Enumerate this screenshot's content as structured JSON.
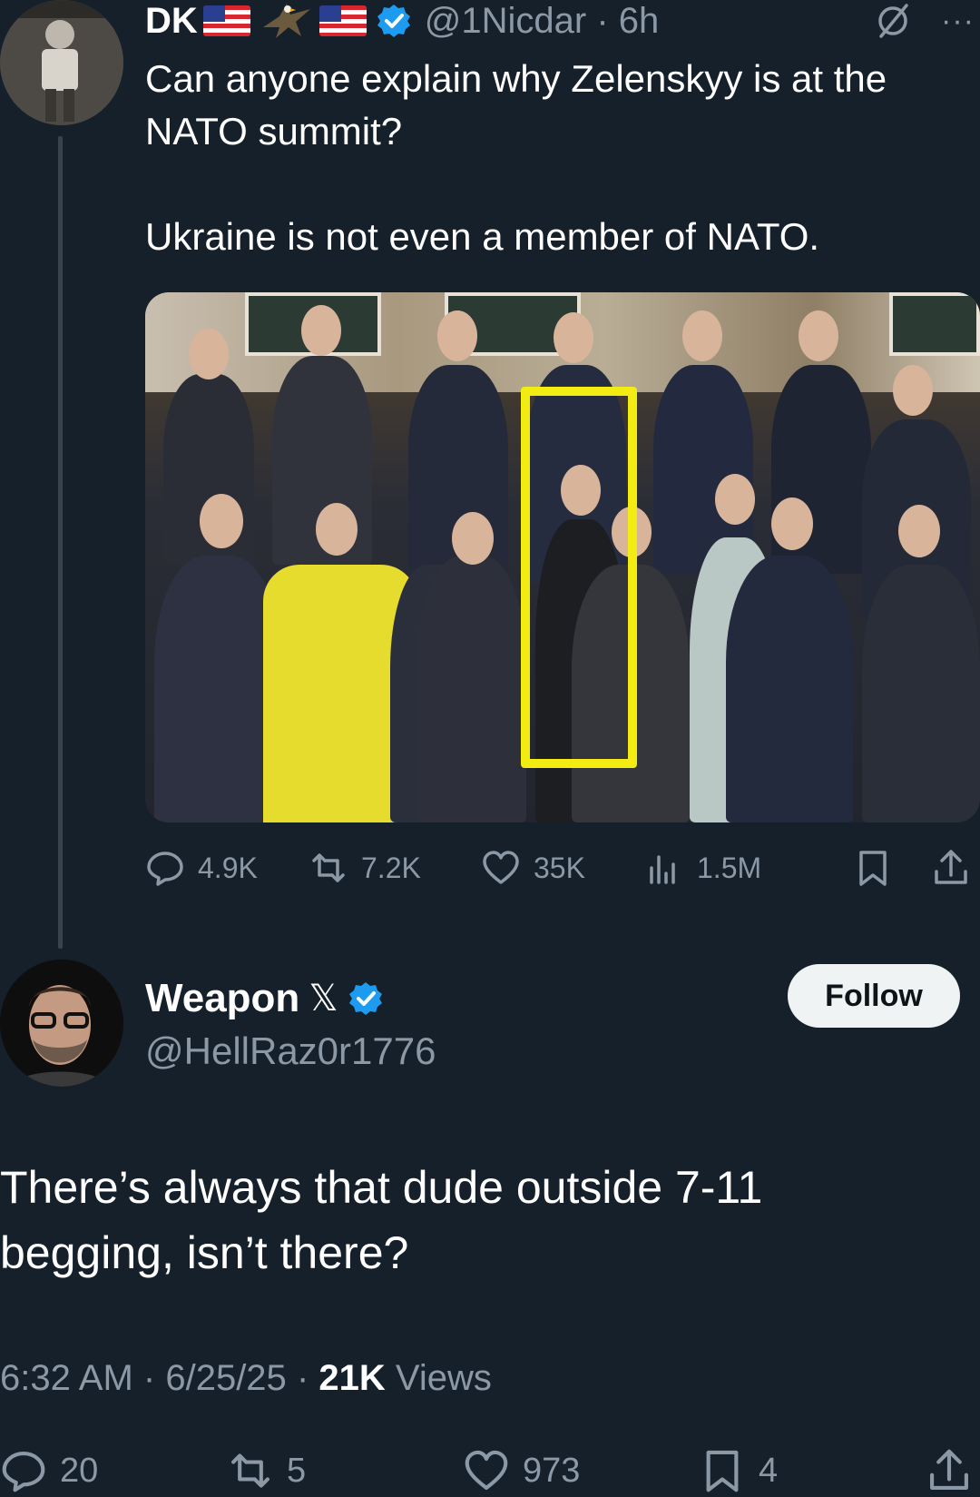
{
  "parent_tweet": {
    "display_name": "DK",
    "handle": "@1Nicdar",
    "time": "6h",
    "separator": "·",
    "text_line_1": "Can anyone explain why Zelenskyy is at the NATO summit?",
    "text_line_2": "Ukraine is not even a member of NATO.",
    "more_label": "···",
    "stats": {
      "replies": "4.9K",
      "reposts": "7.2K",
      "likes": "35K",
      "views": "1.5M"
    }
  },
  "reply_tweet": {
    "display_name": "Weapon",
    "x_mark": "𝕏",
    "handle": "@HellRaz0r1776",
    "follow_label": "Follow",
    "text": "There’s always that dude outside 7-11 begging, isn’t there?",
    "time": "6:32 AM",
    "date": "6/25/25",
    "separator": "·",
    "views_count": "21K",
    "views_label": "Views",
    "stats": {
      "replies": "20",
      "reposts": "5",
      "likes": "973",
      "bookmarks": "4"
    }
  },
  "colors": {
    "background": "#15202b",
    "secondary_text": "#8b98a5",
    "verified_blue": "#1d9bf0",
    "highlight_yellow": "#f2ec12"
  }
}
